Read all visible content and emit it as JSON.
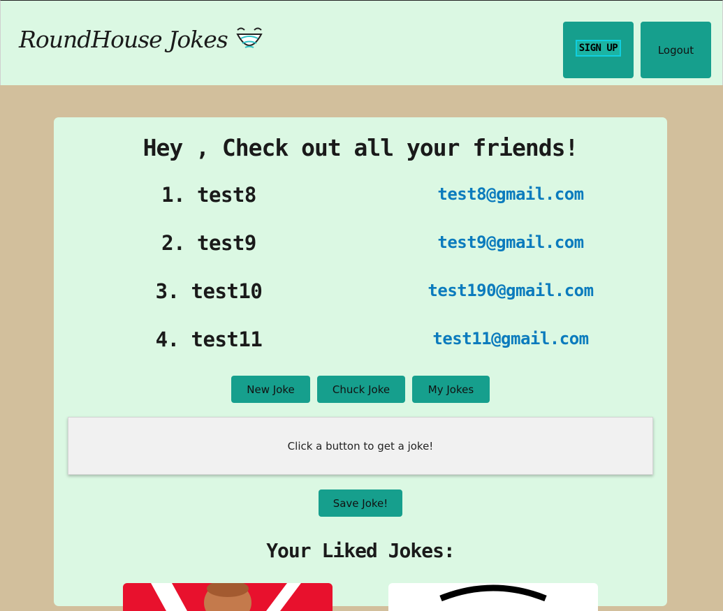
{
  "header": {
    "brand": "RoundHouse Jokes",
    "signup_label": "SIGN UP",
    "logout_label": "Logout"
  },
  "main": {
    "title": "Hey , Check out all your friends!",
    "friends": [
      {
        "name": "1. test8",
        "email": "test8@gmail.com"
      },
      {
        "name": "2. test9",
        "email": "test9@gmail.com"
      },
      {
        "name": "3. test10",
        "email": "test190@gmail.com"
      },
      {
        "name": "4. test11",
        "email": "test11@gmail.com"
      }
    ],
    "buttons": {
      "new_joke": "New Joke",
      "chuck_joke": "Chuck Joke",
      "my_jokes": "My Jokes"
    },
    "joke_placeholder": "Click a button to get a joke!",
    "save_label": "Save Joke!",
    "liked_title": "Your Liked Jokes:"
  },
  "colors": {
    "page_bg": "#d2bf9c",
    "panel_bg": "#dbf8e3",
    "button": "#169f8d",
    "email_link": "#0b7bbd"
  }
}
